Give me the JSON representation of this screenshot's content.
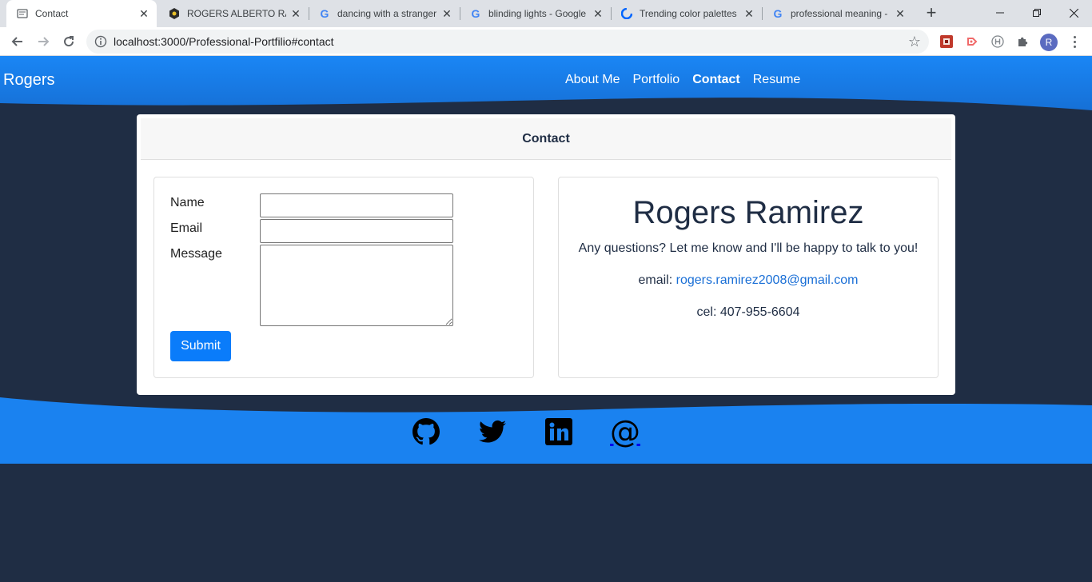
{
  "browser": {
    "tabs": [
      {
        "title": "Contact",
        "active": true,
        "favicon": "page-icon"
      },
      {
        "title": "ROGERS ALBERTO RAM",
        "active": false,
        "favicon": "hex-logo-icon"
      },
      {
        "title": "dancing with a stranger",
        "active": false,
        "favicon": "google-icon"
      },
      {
        "title": "blinding lights - Google",
        "active": false,
        "favicon": "google-icon"
      },
      {
        "title": "Trending color palettes",
        "active": false,
        "favicon": "coolors-icon"
      },
      {
        "title": "professional meaning -",
        "active": false,
        "favicon": "google-icon"
      }
    ],
    "url": "localhost:3000/Professional-Portfilio#contact",
    "profile_initial": "R"
  },
  "site": {
    "brand": "Rogers",
    "nav": [
      {
        "label": "About Me",
        "current": false
      },
      {
        "label": "Portfolio",
        "current": false
      },
      {
        "label": "Contact",
        "current": true
      },
      {
        "label": "Resume",
        "current": false
      }
    ]
  },
  "contact": {
    "card_title": "Contact",
    "form": {
      "name_label": "Name",
      "email_label": "Email",
      "message_label": "Message",
      "name_value": "",
      "email_value": "",
      "message_value": "",
      "submit_label": "Submit"
    },
    "info": {
      "name": "Rogers Ramirez",
      "tagline": "Any questions? Let me know and I'll be happy to talk to you!",
      "email_prefix": "email:",
      "email": "rogers.ramirez2008@gmail.com",
      "phone": "cel: 407-955-6604"
    }
  },
  "footer": {
    "links": [
      "github-icon",
      "twitter-icon",
      "linkedin-icon",
      "email-at-icon"
    ]
  },
  "colors": {
    "header_blue": "#1a82f0",
    "background_navy": "#1f2d44",
    "submit_blue": "#0a7cfa",
    "link_blue": "#1a6fd6"
  }
}
